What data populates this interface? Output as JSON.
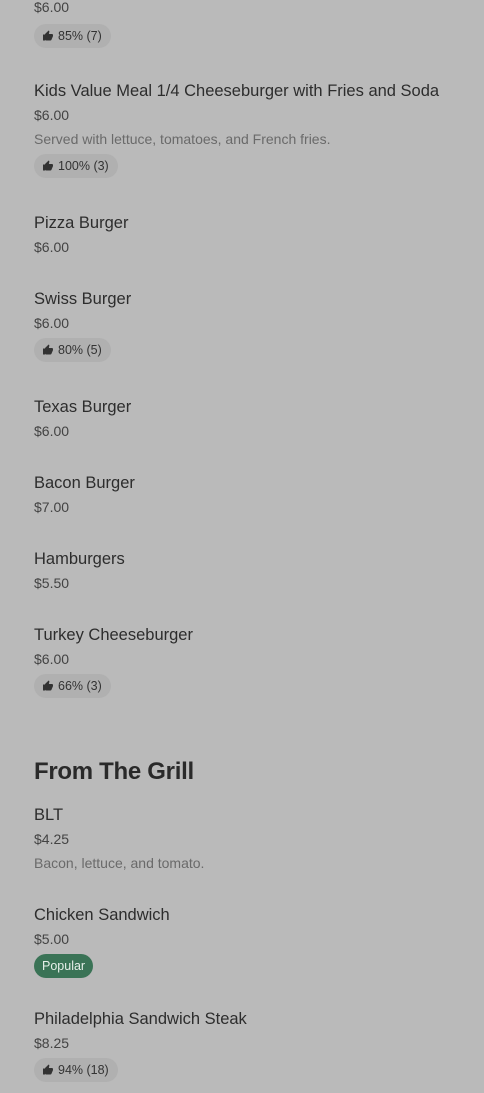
{
  "items_top": [
    {
      "price": "$6.00",
      "rating": "85% (7)"
    },
    {
      "name": "Kids Value Meal 1/4 Cheeseburger with Fries and Soda",
      "price": "$6.00",
      "desc": "Served with lettuce, tomatoes, and French fries.",
      "rating": "100% (3)"
    },
    {
      "name": "Pizza Burger",
      "price": "$6.00"
    },
    {
      "name": "Swiss Burger",
      "price": "$6.00",
      "rating": "80% (5)"
    },
    {
      "name": "Texas Burger",
      "price": "$6.00"
    },
    {
      "name": "Bacon Burger",
      "price": "$7.00"
    },
    {
      "name": "Hamburgers",
      "price": "$5.50"
    },
    {
      "name": "Turkey Cheeseburger",
      "price": "$6.00",
      "rating": "66% (3)"
    }
  ],
  "section_grill": {
    "title": "From The Grill",
    "items": [
      {
        "name": "BLT",
        "price": "$4.25",
        "desc": "Bacon, lettuce, and tomato."
      },
      {
        "name": "Chicken Sandwich",
        "price": "$5.00",
        "badge": "Popular"
      },
      {
        "name": "Philadelphia Sandwich Steak",
        "price": "$8.25",
        "rating": "94% (18)"
      }
    ]
  },
  "icons": {
    "rating": "thumbs-up-icon"
  },
  "colors": {
    "background": "#bababa",
    "popular_badge": "#3a7356"
  }
}
